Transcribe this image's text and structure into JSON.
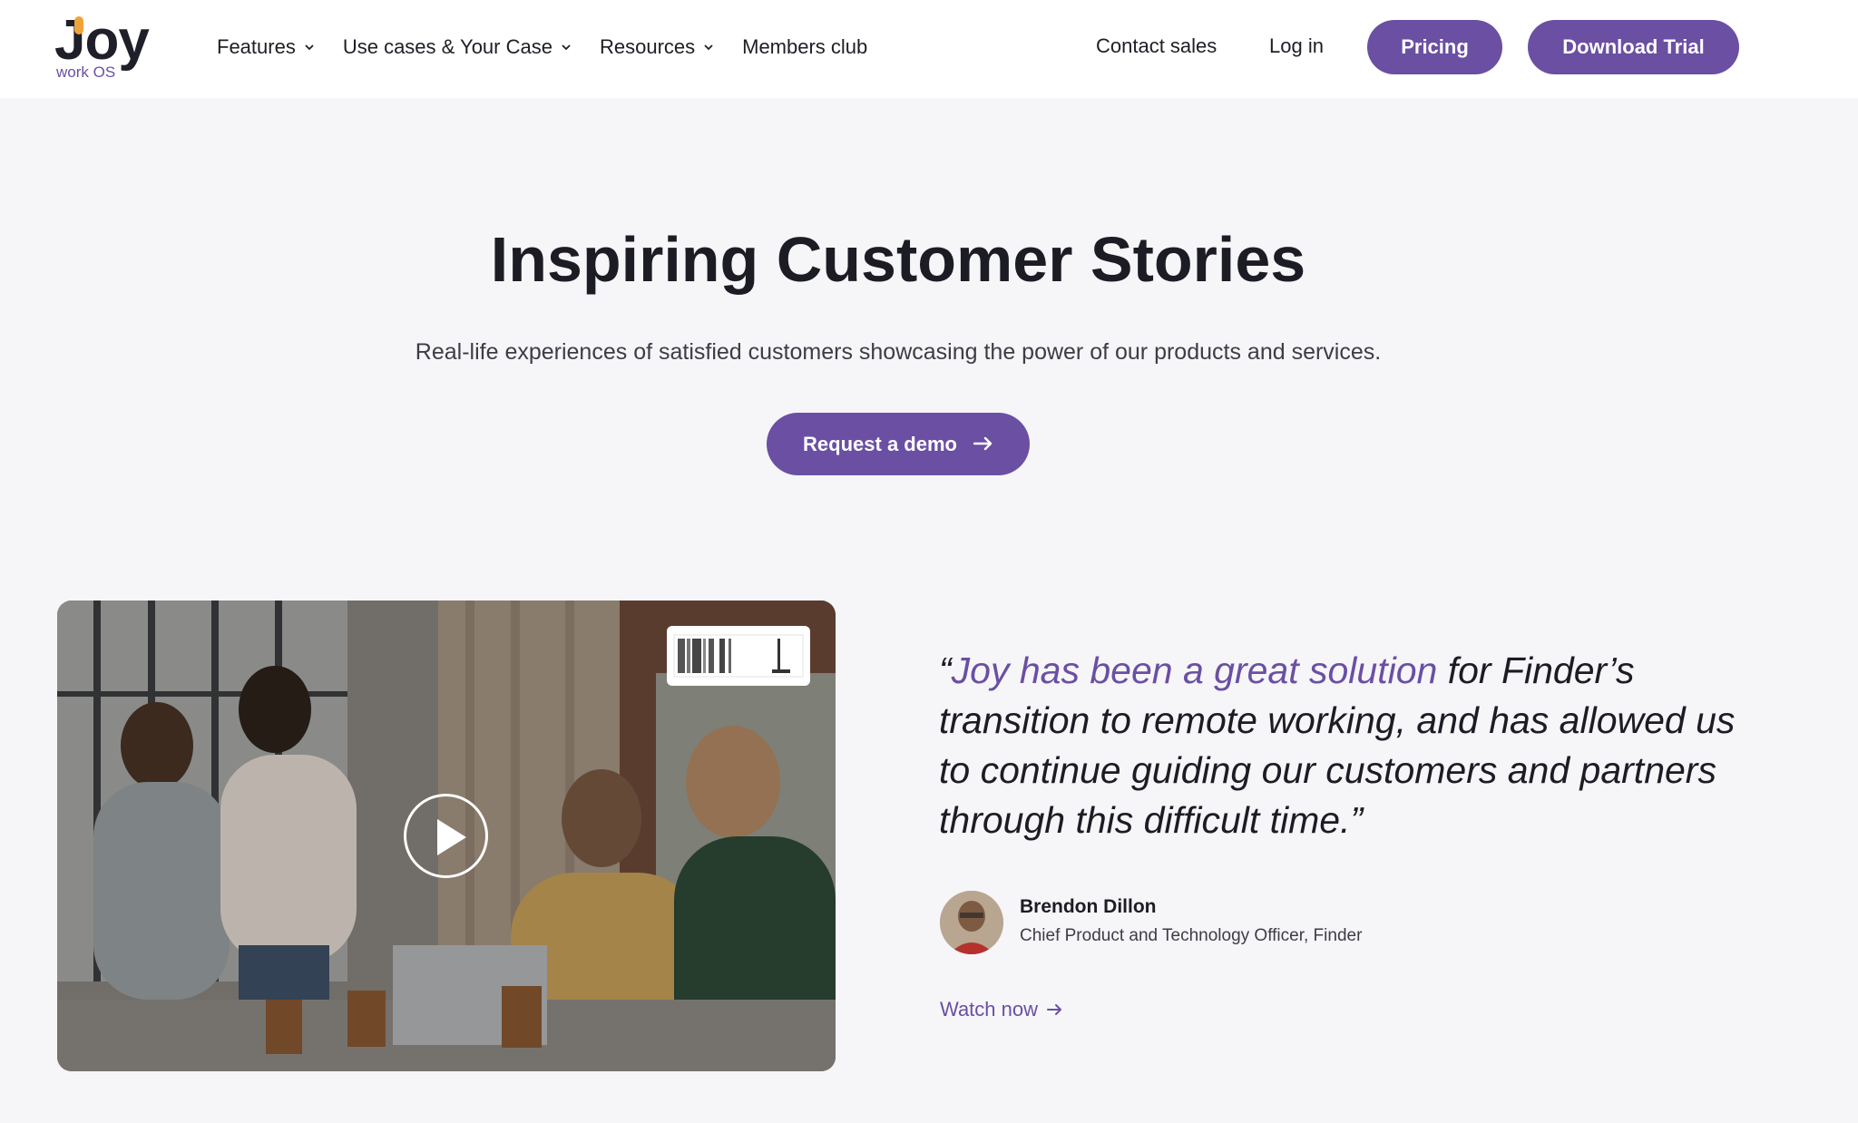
{
  "brand": {
    "logo_text": "Joy",
    "logo_sub": "work OS",
    "accent_color": "#6a4fa3",
    "logo_dot_orange": "#f0a33a",
    "logo_dot_red": "#e0463a"
  },
  "nav": {
    "items": [
      {
        "label": "Features",
        "has_dropdown": true
      },
      {
        "label": "Use cases & Your Case",
        "has_dropdown": true
      },
      {
        "label": "Resources",
        "has_dropdown": true
      },
      {
        "label": "Members club",
        "has_dropdown": false
      }
    ],
    "contact_sales": "Contact sales",
    "login": "Log in",
    "pricing": "Pricing",
    "download_trial": "Download Trial"
  },
  "hero": {
    "title": "Inspiring Customer Stories",
    "subtitle": "Real-life experiences of satisfied customers showcasing the power of our products and services.",
    "cta_label": "Request a demo",
    "cta_icon": "arrow-right-icon"
  },
  "video": {
    "play_icon": "play-icon"
  },
  "testimonial": {
    "quote_open": "“",
    "quote_highlight": "Joy has been a great solution",
    "quote_rest": " for Finder’s transition to remote working, and has allowed us to continue guiding our customers and partners through this difficult time.”",
    "person_name": "Brendon Dillon",
    "person_role": "Chief Product and Technology Officer, Finder",
    "watch_label": "Watch now",
    "watch_icon": "arrow-right-icon"
  }
}
